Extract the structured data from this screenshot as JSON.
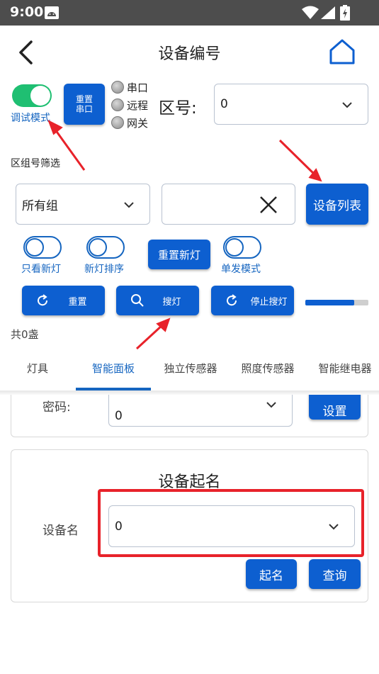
{
  "status_bar": {
    "time": "9:00"
  },
  "header": {
    "title": "设备编号"
  },
  "controls": {
    "debug_mode_label": "调试模式",
    "reset_serial_line1": "重置",
    "reset_serial_line2": "串口",
    "radio_options": [
      "串口",
      "远程",
      "网关"
    ],
    "zone_label": "区号:",
    "zone_value": "0"
  },
  "group_filter": {
    "label": "区组号筛选",
    "group_value": "所有组",
    "input_value": "",
    "device_list_button": "设备列表"
  },
  "options": {
    "new_lights_only": "只看新灯",
    "new_lights_sort": "新灯排序",
    "reset_new_lights": "重置新灯",
    "single_send_mode": "单发模式"
  },
  "actions": {
    "reset": "重置",
    "search_lights": "搜灯",
    "stop_search": "停止搜灯",
    "progress_percent": 78
  },
  "count_text": "共0盏",
  "tabs": [
    "灯具",
    "智能面板",
    "独立传感器",
    "照度传感器",
    "智能继电器"
  ],
  "active_tab": 1,
  "password_card": {
    "label": "密码:",
    "value": "0",
    "set_button": "设置"
  },
  "naming_card": {
    "title": "设备起名",
    "device_name_label": "设备名",
    "device_name_value": "0",
    "name_button": "起名",
    "query_button": "查询"
  },
  "colors": {
    "primary_blue": "#0d5fd0",
    "toggle_green": "#1fbf72",
    "annotation_red": "#e8222a"
  }
}
